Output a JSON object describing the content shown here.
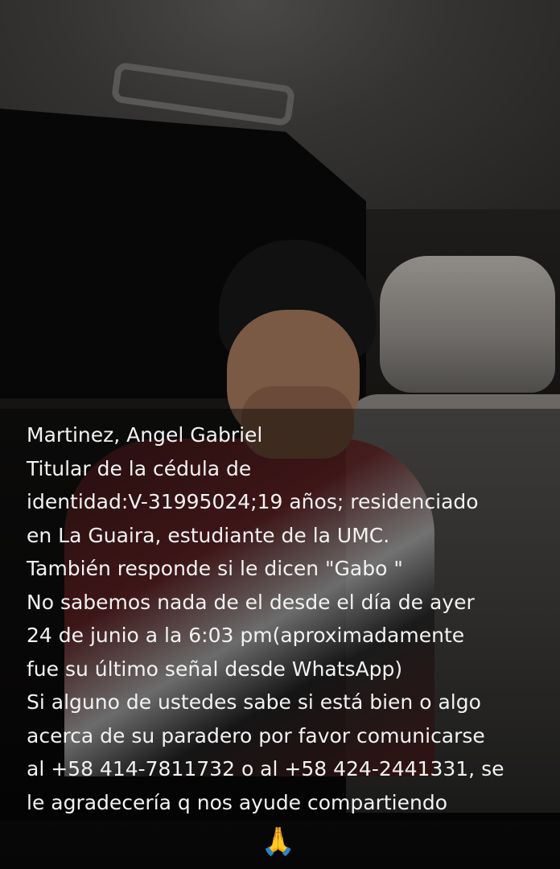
{
  "caption": {
    "lines": [
      "Martinez, Angel Gabriel",
      "Titular de la cédula de",
      "identidad:V-31995024;19 años; residenciado",
      "en La Guaira, estudiante de la UMC.",
      "También responde si le dicen \"Gabo \"",
      "No sabemos nada de el desde el día de ayer",
      "24 de junio a la 6:03 pm(aproximadamente",
      "fue su último señal desde WhatsApp)",
      "Si alguno de ustedes sabe si está bien o algo",
      "acerca de su paradero por favor comunicarse",
      "al +58 414-7811732 o al +58 424-2441331, se",
      "le agradecería q nos ayude compartiendo"
    ]
  },
  "emoji": {
    "glyph": "🙏",
    "name": "folded-hands-icon"
  },
  "colors": {
    "text": "#f2f2f2",
    "backdrop": "#000000"
  }
}
